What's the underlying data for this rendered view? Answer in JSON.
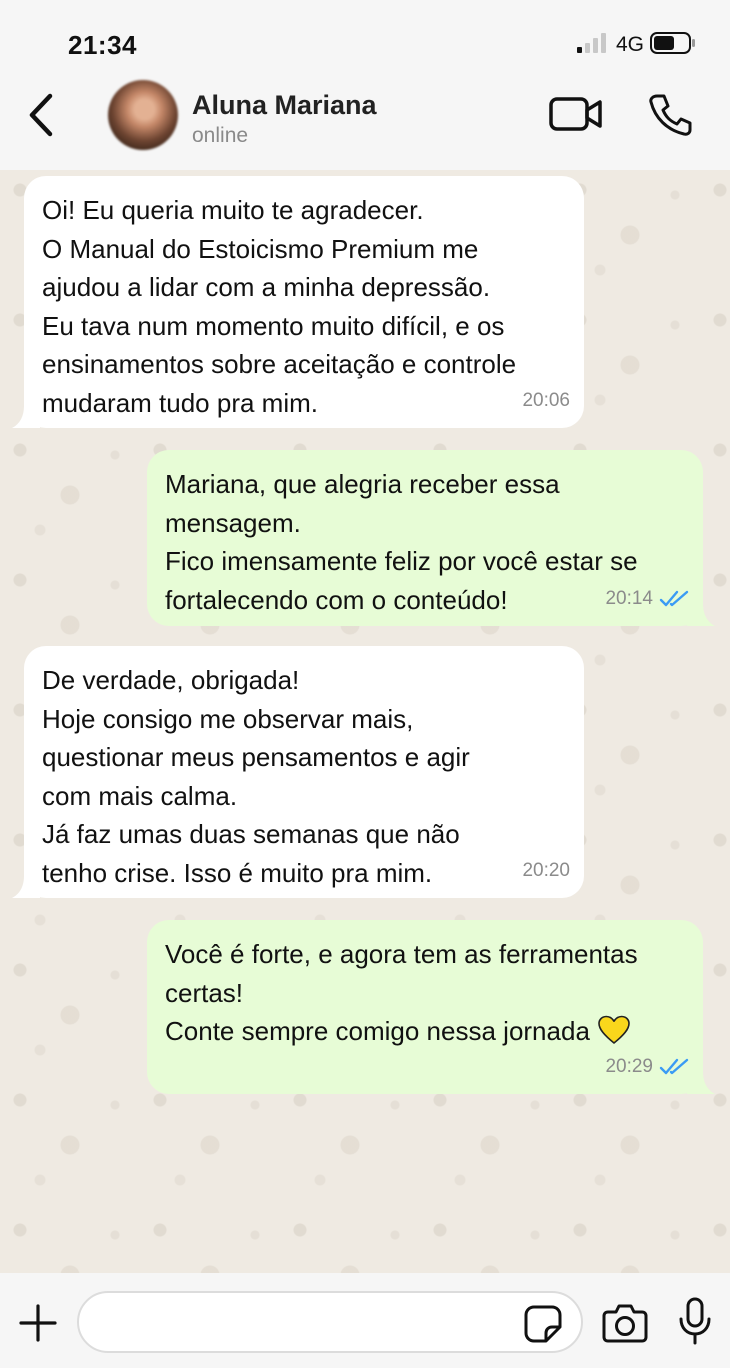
{
  "status_bar": {
    "time": "21:34",
    "network": "4G",
    "icons": [
      "signal-icon",
      "battery-icon"
    ]
  },
  "header": {
    "contact_name": "Aluna Mariana",
    "contact_status": "online",
    "icons": [
      "back-icon",
      "video-call-icon",
      "voice-call-icon"
    ]
  },
  "messages": [
    {
      "direction": "incoming",
      "lines": [
        "Oi! Eu queria muito te agradecer.",
        "O Manual do Estoicismo Premium me",
        "ajudou a lidar com a minha depressão.",
        "Eu tava num momento muito difícil, e os",
        "ensinamentos sobre aceitação e controle",
        "mudaram tudo pra mim."
      ],
      "time": "20:06"
    },
    {
      "direction": "outgoing",
      "lines": [
        "Mariana, que alegria receber essa",
        "mensagem.",
        "Fico imensamente feliz por você estar se",
        "fortalecendo com o conteúdo!"
      ],
      "time": "20:14",
      "read": true
    },
    {
      "direction": "incoming",
      "lines": [
        "De verdade, obrigada!",
        "Hoje consigo me observar mais,",
        "questionar meus pensamentos e agir",
        "com mais calma.",
        "Já faz umas duas semanas que não",
        "tenho crise. Isso é muito pra mim."
      ],
      "time": "20:20"
    },
    {
      "direction": "outgoing",
      "lines": [
        "Você é forte, e agora tem as ferramentas",
        "certas!",
        "Conte sempre comigo nessa jornada"
      ],
      "emoji": "yellow-heart-icon",
      "time": "20:29",
      "read": true
    }
  ],
  "input_bar": {
    "placeholder": "",
    "icons": [
      "plus-icon",
      "sticker-icon",
      "camera-icon",
      "mic-icon"
    ]
  },
  "colors": {
    "incoming_bubble": "#ffffff",
    "outgoing_bubble": "#e7fcd6",
    "read_ticks": "#3b9bf4",
    "chat_background": "#efeae2",
    "heart": "#f9d71c"
  }
}
